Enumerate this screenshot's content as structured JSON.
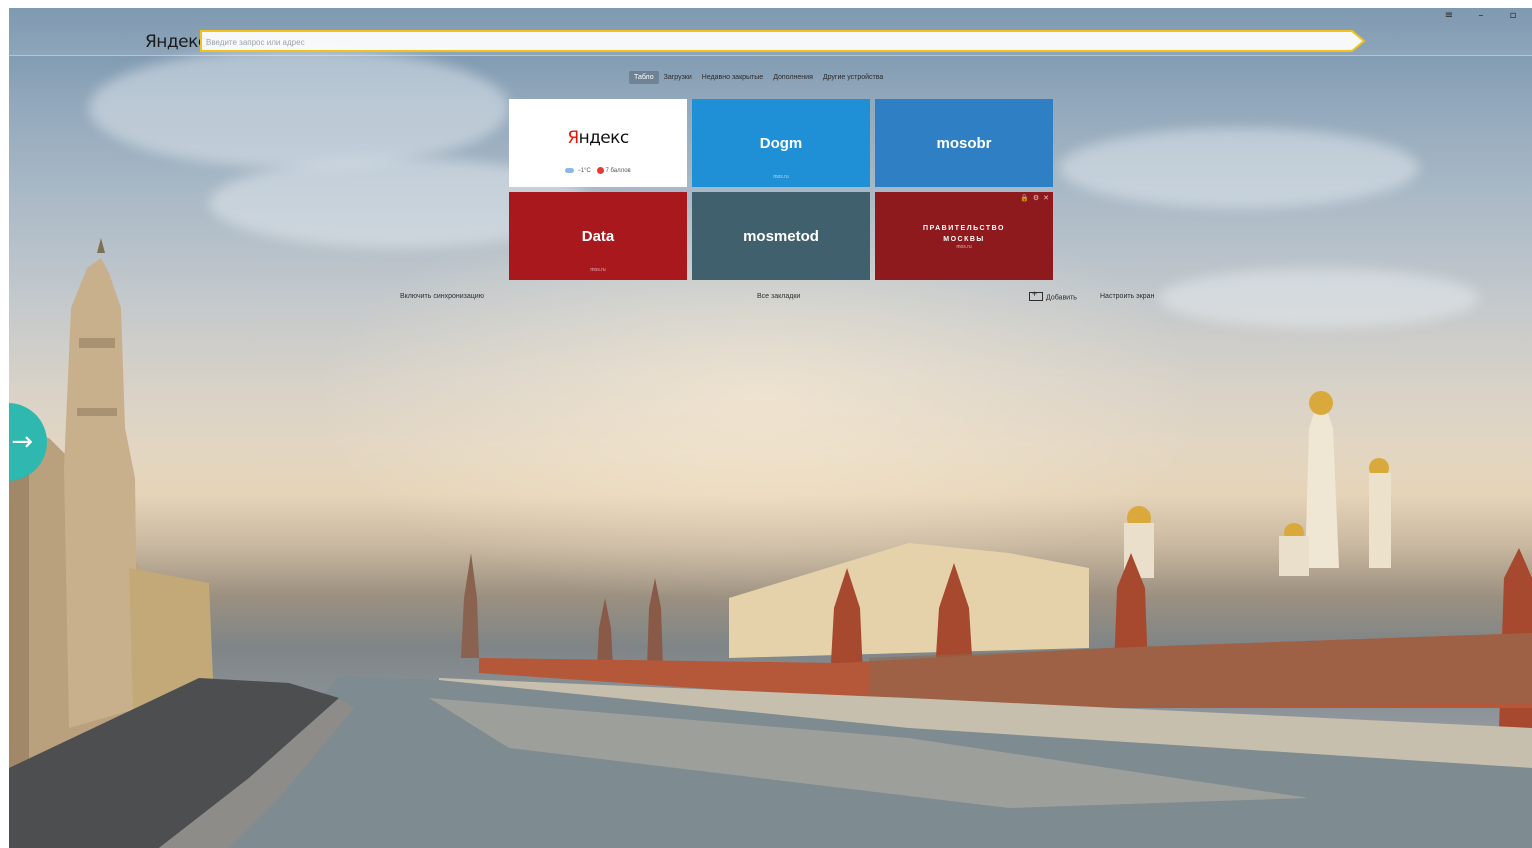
{
  "browser": {
    "logo": "Яндекс",
    "omnibox_placeholder": "Введите запрос или адрес",
    "window_controls": {
      "menu": "≡",
      "minimize": "–",
      "restore": "▫"
    }
  },
  "nav": {
    "tabs": [
      {
        "label": "Табло",
        "active": true
      },
      {
        "label": "Загрузки",
        "active": false
      },
      {
        "label": "Недавно закрытые",
        "active": false
      },
      {
        "label": "Дополнения",
        "active": false
      },
      {
        "label": "Другие устройства",
        "active": false
      }
    ]
  },
  "tiles": [
    {
      "type": "yandex",
      "logo_first": "Я",
      "logo_rest": "ндекс",
      "weather": "−1°C",
      "traffic": "7 баллов",
      "color": "#ffffff"
    },
    {
      "type": "site",
      "title": "Dogm",
      "sub": "mos.ru",
      "color": "#1f8fd6"
    },
    {
      "type": "site",
      "title": "mosobr",
      "sub": "",
      "color": "#2f7fc4"
    },
    {
      "type": "site",
      "title": "Data",
      "sub": "mos.ru",
      "color": "#a8181c"
    },
    {
      "type": "site",
      "title": "mosmetod",
      "sub": "",
      "color": "#41606d"
    },
    {
      "type": "gov",
      "title_line1": "ПРАВИТЕЛЬСТВО",
      "title_line2": "МОСКВЫ",
      "sub": "mos.ru",
      "color": "#8e1a1e",
      "tools": {
        "lock": "🔒",
        "settings": "⚙",
        "close": "✕"
      }
    }
  ],
  "bottom": {
    "sync": "Включить синхронизацию",
    "all_bookmarks": "Все закладки",
    "add": "Добавить",
    "customize": "Настроить экран"
  },
  "colors": {
    "omnibox_border": "#f2c21a",
    "side_arrow": "#2fb8b0",
    "active_tab_bg": "#5a6570"
  }
}
